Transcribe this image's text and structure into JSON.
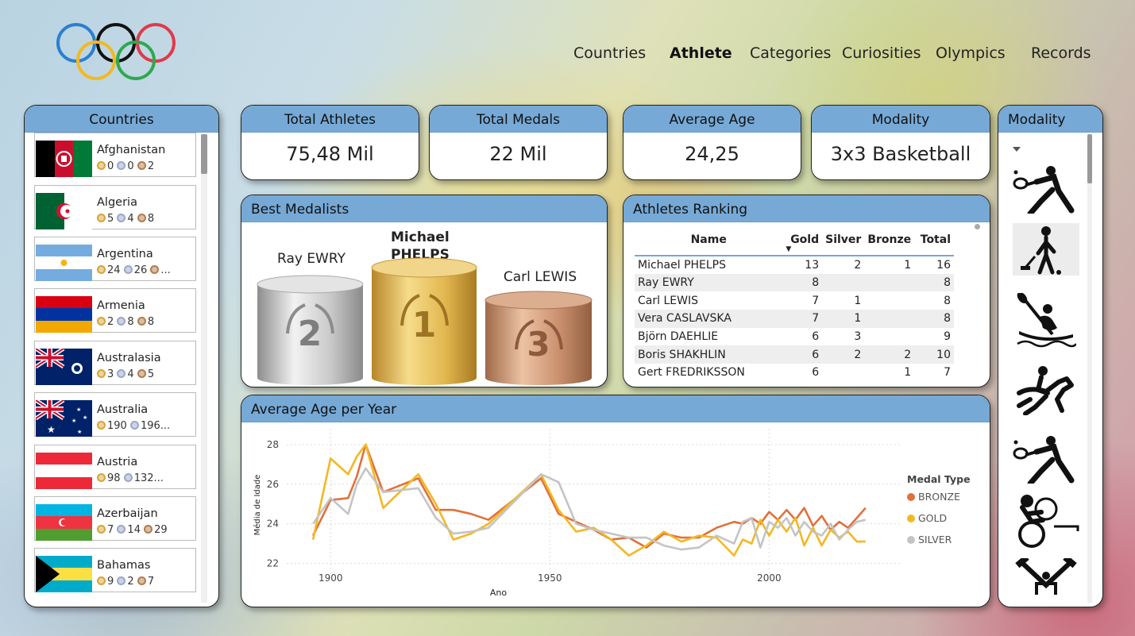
{
  "nav": {
    "items": [
      "Countries",
      "Athlete",
      "Categories",
      "Curiosities",
      "Olympics",
      "Records"
    ],
    "active": "Athlete"
  },
  "countries_panel": {
    "title": "Countries",
    "items": [
      {
        "name": "Afghanistan",
        "gold": "0",
        "silver": "0",
        "bronze": "2"
      },
      {
        "name": "Algeria",
        "gold": "5",
        "silver": "4",
        "bronze": "8"
      },
      {
        "name": "Argentina",
        "gold": "24",
        "silver": "26",
        "bronze": "..."
      },
      {
        "name": "Armenia",
        "gold": "2",
        "silver": "8",
        "bronze": "8"
      },
      {
        "name": "Australasia",
        "gold": "3",
        "silver": "4",
        "bronze": "5"
      },
      {
        "name": "Australia",
        "gold": "190",
        "silver": "196...",
        "bronze": ""
      },
      {
        "name": "Austria",
        "gold": "98",
        "silver": "132...",
        "bronze": ""
      },
      {
        "name": "Azerbaijan",
        "gold": "7",
        "silver": "14",
        "bronze": "29"
      },
      {
        "name": "Bahamas",
        "gold": "9",
        "silver": "2",
        "bronze": "7"
      }
    ]
  },
  "kpis": {
    "total_athletes": {
      "label": "Total Athletes",
      "value": "75,48 Mil"
    },
    "total_medals": {
      "label": "Total Medals",
      "value": "22 Mil"
    },
    "average_age": {
      "label": "Average Age",
      "value": "24,25"
    },
    "modality": {
      "label": "Modality",
      "value": "3x3 Basketball"
    }
  },
  "best_medalists": {
    "title": "Best Medalists",
    "first": "Michael PHELPS",
    "second": "Ray EWRY",
    "third": "Carl LEWIS"
  },
  "ranking": {
    "title": "Athletes Ranking",
    "columns": [
      "Name",
      "Gold",
      "Silver",
      "Bronze",
      "Total"
    ],
    "rows": [
      [
        "Michael PHELPS",
        "13",
        "2",
        "1",
        "16"
      ],
      [
        "Ray EWRY",
        "8",
        "",
        "",
        "8"
      ],
      [
        "Carl LEWIS",
        "7",
        "1",
        "",
        "8"
      ],
      [
        "Vera CASLAVSKA",
        "7",
        "1",
        "",
        "8"
      ],
      [
        "Björn DAEHLIE",
        "6",
        "3",
        "",
        "9"
      ],
      [
        "Boris SHAKHLIN",
        "6",
        "2",
        "2",
        "10"
      ],
      [
        "Gert FREDRIKSSON",
        "6",
        "",
        "1",
        "7"
      ]
    ]
  },
  "modality_panel": {
    "title": "Modality",
    "icons": [
      "tennis-icon",
      "croquet-icon",
      "canoe-slalom-icon",
      "equestrian-icon",
      "badminton-icon",
      "cycling-bmx-icon",
      "roque-icon"
    ]
  },
  "colors": {
    "header_blue": "#76a9d6",
    "bronze": "#e2703a",
    "gold": "#f2b824",
    "silver": "#c4c4c4"
  },
  "chart_data": {
    "type": "line",
    "title": "Average Age per Year",
    "xlabel": "Ano",
    "ylabel": "Média de Idade",
    "xlim": [
      1890,
      2030
    ],
    "ylim": [
      21.5,
      28.8
    ],
    "xticks": [
      1900,
      1950,
      2000
    ],
    "yticks": [
      22,
      24,
      26,
      28
    ],
    "legend_title": "Medal Type",
    "legend_position": "right",
    "series": [
      {
        "name": "BRONZE",
        "color": "#e2703a",
        "x": [
          1896,
          1900,
          1904,
          1906,
          1908,
          1912,
          1920,
          1924,
          1928,
          1932,
          1936,
          1948,
          1952,
          1956,
          1960,
          1964,
          1968,
          1972,
          1976,
          1980,
          1984,
          1988,
          1992,
          1994,
          1996,
          1998,
          2000,
          2002,
          2004,
          2006,
          2008,
          2010,
          2012,
          2014,
          2016,
          2018,
          2020,
          2022
        ],
        "y": [
          23.4,
          25.2,
          25.3,
          26.4,
          28.0,
          25.6,
          26.3,
          24.7,
          24.7,
          24.5,
          24.2,
          26.3,
          24.5,
          24.1,
          23.7,
          23.2,
          23.3,
          22.8,
          23.5,
          23.3,
          23.3,
          23.8,
          24.1,
          24.0,
          24.3,
          24.0,
          24.6,
          24.2,
          24.7,
          24.2,
          24.8,
          23.9,
          24.4,
          23.7,
          24.1,
          23.8,
          24.3,
          24.8
        ]
      },
      {
        "name": "GOLD",
        "color": "#f2b824",
        "x": [
          1896,
          1900,
          1904,
          1906,
          1908,
          1912,
          1920,
          1924,
          1928,
          1932,
          1936,
          1948,
          1952,
          1956,
          1960,
          1964,
          1968,
          1972,
          1976,
          1980,
          1984,
          1988,
          1992,
          1994,
          1996,
          1998,
          2000,
          2002,
          2004,
          2006,
          2008,
          2010,
          2012,
          2014,
          2016,
          2018,
          2020,
          2022
        ],
        "y": [
          23.2,
          27.3,
          26.5,
          27.4,
          28.0,
          24.8,
          26.5,
          25.0,
          23.2,
          23.5,
          24.0,
          26.5,
          24.7,
          23.6,
          23.8,
          23.2,
          22.4,
          22.9,
          23.6,
          23.1,
          23.4,
          23.3,
          22.4,
          23.2,
          23.0,
          24.2,
          23.4,
          24.2,
          23.6,
          24.3,
          22.9,
          23.8,
          22.9,
          23.7,
          23.3,
          23.6,
          23.1,
          23.1
        ]
      },
      {
        "name": "SILVER",
        "color": "#c4c4c4",
        "x": [
          1896,
          1900,
          1904,
          1906,
          1908,
          1912,
          1920,
          1924,
          1928,
          1932,
          1936,
          1948,
          1952,
          1956,
          1960,
          1964,
          1968,
          1972,
          1976,
          1980,
          1984,
          1988,
          1992,
          1994,
          1996,
          1998,
          2000,
          2002,
          2004,
          2006,
          2008,
          2010,
          2012,
          2014,
          2016,
          2018,
          2020,
          2022
        ],
        "y": [
          24.0,
          25.3,
          24.5,
          26.0,
          26.8,
          25.6,
          25.8,
          24.3,
          23.5,
          23.6,
          23.8,
          26.5,
          26.1,
          24.0,
          23.7,
          23.5,
          23.3,
          23.3,
          22.9,
          22.7,
          22.8,
          23.4,
          23.0,
          24.1,
          24.3,
          22.8,
          24.1,
          23.8,
          24.3,
          23.4,
          24.1,
          23.6,
          23.4,
          24.0,
          23.2,
          23.7,
          24.1,
          24.2
        ]
      }
    ]
  }
}
